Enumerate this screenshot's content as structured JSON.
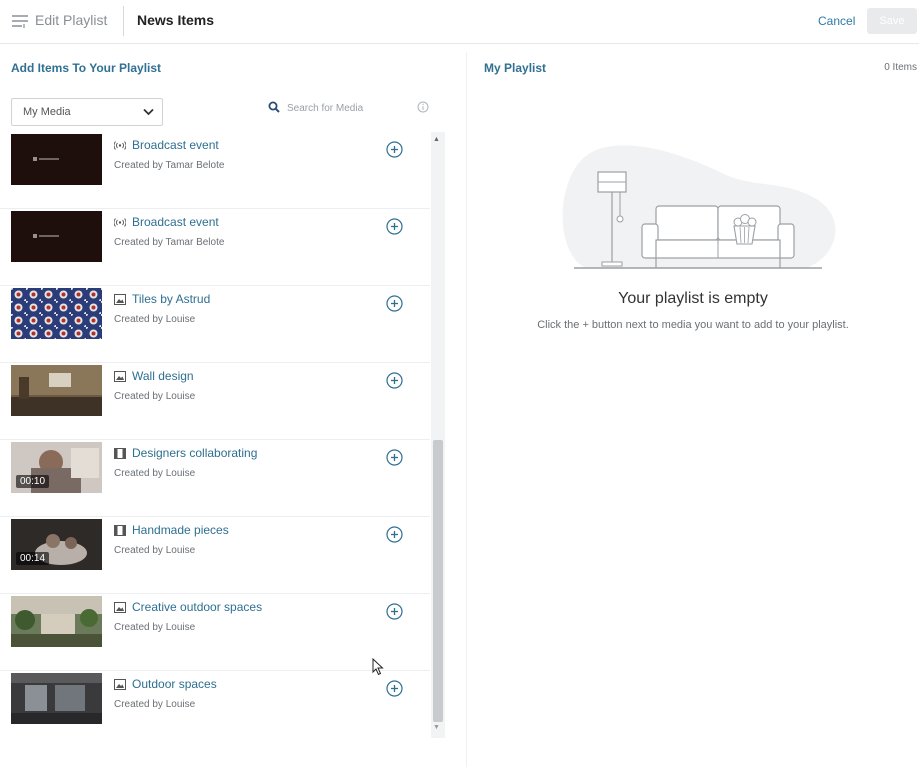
{
  "header": {
    "back_label": "Edit Playlist",
    "title": "News Items",
    "cancel_label": "Cancel",
    "save_label": "Save"
  },
  "left_panel": {
    "title": "Add Items To Your Playlist",
    "source_select": {
      "value": "My Media"
    },
    "search": {
      "placeholder": "Search for Media"
    }
  },
  "media_items": [
    {
      "title": "Broadcast event",
      "creator": "Created by Tamar Belote",
      "type_icon": "broadcast-icon",
      "duration": ""
    },
    {
      "title": "Broadcast event",
      "creator": "Created by Tamar Belote",
      "type_icon": "broadcast-icon",
      "duration": ""
    },
    {
      "title": "Tiles by Astrud",
      "creator": "Created by Louise",
      "type_icon": "image-icon",
      "duration": ""
    },
    {
      "title": "Wall design",
      "creator": "Created by Louise",
      "type_icon": "image-icon",
      "duration": ""
    },
    {
      "title": "Designers collaborating",
      "creator": "Created by Louise",
      "type_icon": "video-icon",
      "duration": "00:10"
    },
    {
      "title": "Handmade pieces",
      "creator": "Created by Louise",
      "type_icon": "video-icon",
      "duration": "00:14"
    },
    {
      "title": "Creative outdoor spaces",
      "creator": "Created by Louise",
      "type_icon": "image-icon",
      "duration": ""
    },
    {
      "title": "Outdoor spaces",
      "creator": "Created by Louise",
      "type_icon": "image-icon",
      "duration": ""
    }
  ],
  "right_panel": {
    "title": "My Playlist",
    "count": "0 Items",
    "empty_title": "Your playlist is empty",
    "empty_desc": "Click the + button next to media you want to add to your playlist."
  },
  "colors": {
    "accent": "#2f7093",
    "link": "#2e7aa6",
    "disabled_button": "#e8eaec"
  }
}
